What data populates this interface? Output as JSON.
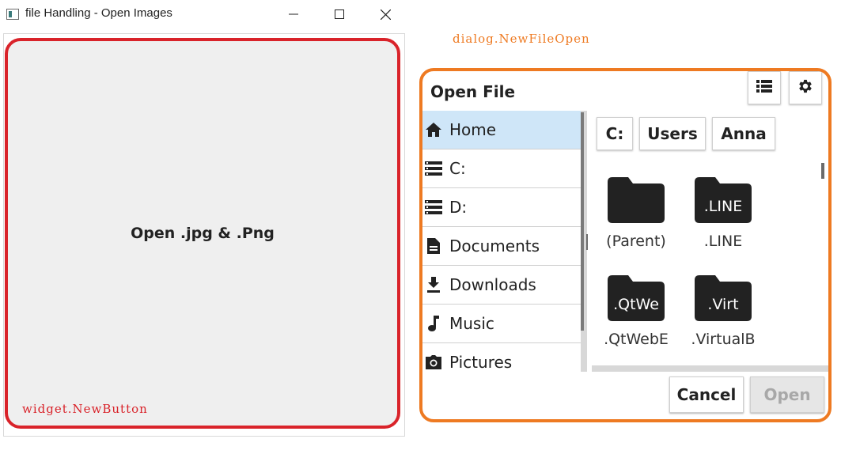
{
  "window": {
    "title": "file Handling - Open Images",
    "button_label": "Open .jpg & .Png",
    "annotation": "widget.NewButton"
  },
  "dialog": {
    "annotation": "dialog.NewFileOpen",
    "title": "Open File",
    "sidebar": [
      {
        "label": "Home",
        "icon": "home-icon"
      },
      {
        "label": "C:",
        "icon": "drive-icon"
      },
      {
        "label": "D:",
        "icon": "drive-icon"
      },
      {
        "label": "Documents",
        "icon": "document-icon"
      },
      {
        "label": "Downloads",
        "icon": "download-icon"
      },
      {
        "label": "Music",
        "icon": "music-icon"
      },
      {
        "label": "Pictures",
        "icon": "camera-icon"
      }
    ],
    "breadcrumb": [
      "C:",
      "Users",
      "Anna"
    ],
    "files": [
      {
        "name": "(Parent)",
        "badge": ""
      },
      {
        "name": ".LINE",
        "badge": ".LINE"
      },
      {
        "name": ".QtWebE",
        "badge": ".QtWe"
      },
      {
        "name": ".VirtualB",
        "badge": ".Virt"
      }
    ],
    "cancel_label": "Cancel",
    "open_label": "Open",
    "accent_color": "#ee7a22",
    "button_outline_color": "#d9232a",
    "selected_color": "#cfe6f8"
  }
}
